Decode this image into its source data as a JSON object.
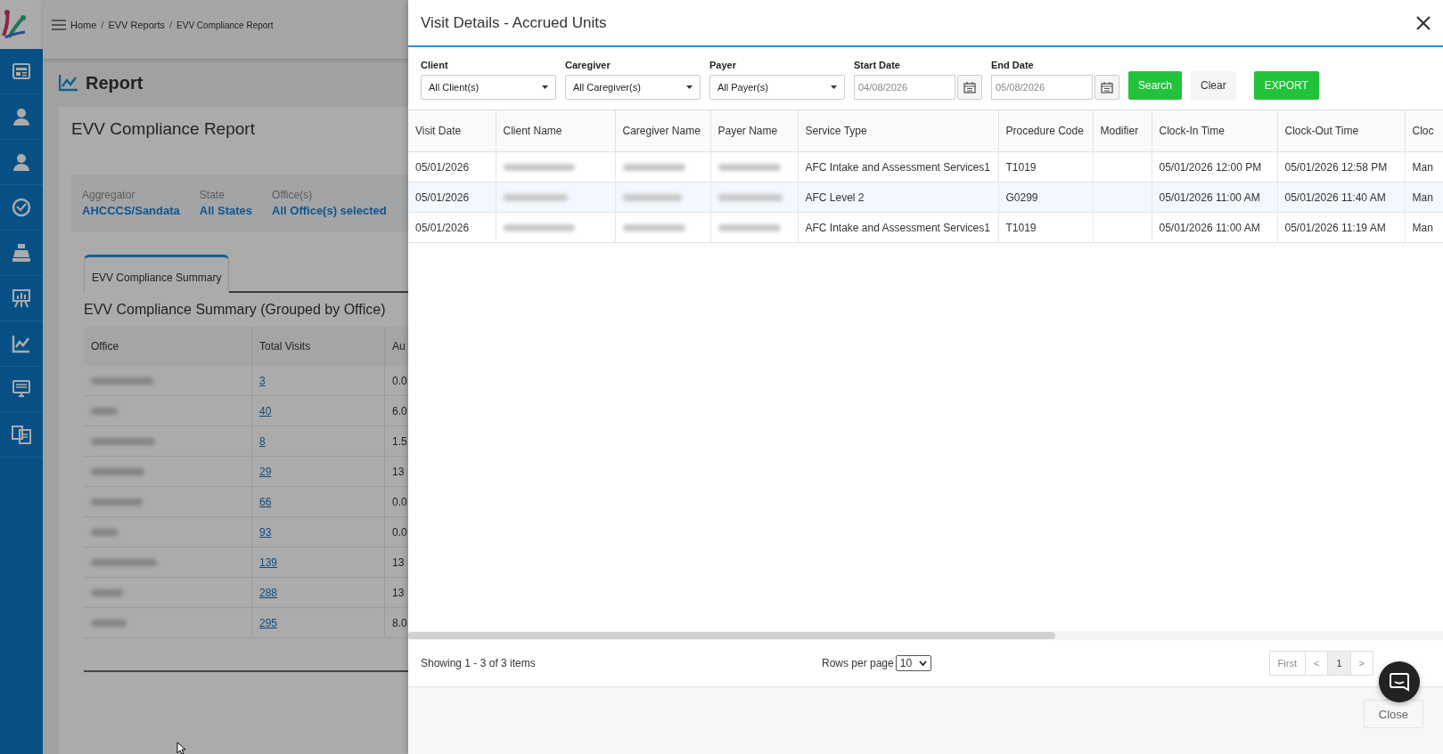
{
  "breadcrumb": {
    "items": [
      "Home",
      "EVV Reports",
      "EVV Compliance Report"
    ],
    "separator": "/"
  },
  "page_title": "Report",
  "report": {
    "title": "EVV Compliance Report",
    "filters": [
      {
        "label": "Aggregator",
        "value": "AHCCCS/Sandata"
      },
      {
        "label": "State",
        "value": "All States"
      },
      {
        "label": "Office(s)",
        "value": "All Office(s) selected"
      }
    ],
    "tabs": [
      {
        "label": "EVV Compliance Summary",
        "selected": true
      }
    ],
    "summary_title": "EVV Compliance Summary (Grouped by Office)",
    "table": {
      "columns": [
        "Office",
        "Total Visits",
        "Au"
      ],
      "rows": [
        {
          "total_visits": "3",
          "column_3": "0.0"
        },
        {
          "total_visits": "40",
          "column_3": "6.0"
        },
        {
          "total_visits": "8",
          "column_3": "1.5"
        },
        {
          "total_visits": "29",
          "column_3": "13"
        },
        {
          "total_visits": "66",
          "column_3": "0.0"
        },
        {
          "total_visits": "93",
          "column_3": "0.0"
        },
        {
          "total_visits": "139",
          "column_3": "13"
        },
        {
          "total_visits": "288",
          "column_3": "13"
        },
        {
          "total_visits": "295",
          "column_3": "8.0"
        }
      ]
    }
  },
  "modal": {
    "title": "Visit Details - Accrued Units",
    "filters": [
      {
        "label": "Client",
        "kind": "select",
        "value": "All Client(s)"
      },
      {
        "label": "Caregiver",
        "kind": "select",
        "value": "All Caregiver(s)"
      },
      {
        "label": "Payer",
        "kind": "select",
        "value": "All Payer(s)"
      },
      {
        "label": "Start Date",
        "kind": "date",
        "value": "04/08/2026"
      },
      {
        "label": "End Date",
        "kind": "date",
        "value": "05/08/2026"
      }
    ],
    "buttons": [
      {
        "label": "Search",
        "kind": "primary"
      },
      {
        "label": "Clear",
        "kind": "plain"
      },
      {
        "label": "EXPORT",
        "kind": "export"
      }
    ],
    "table": {
      "columns": [
        "Visit Date",
        "Client Name",
        "Caregiver Name",
        "Payer Name",
        "Service Type",
        "Procedure Code",
        "Modifier",
        "Clock-In Time",
        "Clock-Out Time",
        "Cloc"
      ],
      "rows": [
        {
          "highlighted": false,
          "visit_date": "05/01/2026",
          "service_type": "AFC Intake and Assessment Services1",
          "procedure_code": "T1019",
          "clock_in": "05/01/2026 12:00 PM",
          "clock_out": "05/01/2026 12:58 PM",
          "column_10": "Man"
        },
        {
          "highlighted": true,
          "visit_date": "05/01/2026",
          "service_type": "AFC Level 2",
          "procedure_code": "G0299",
          "clock_in": "05/01/2026 11:00 AM",
          "clock_out": "05/01/2026 11:40 AM",
          "column_10": "Man"
        },
        {
          "highlighted": false,
          "visit_date": "05/01/2026",
          "service_type": "AFC Intake and Assessment Services1",
          "procedure_code": "T1019",
          "clock_in": "05/01/2026 11:00 AM",
          "clock_out": "05/01/2026 11:19 AM",
          "column_10": "Man"
        }
      ]
    },
    "summary": "Showing 1 - 3 of 3 items",
    "rows_per_page": {
      "label": "Rows per page",
      "value": "10"
    },
    "pagination": [
      {
        "label": "First",
        "selected": false
      },
      {
        "label": "<",
        "selected": false
      },
      {
        "label": "1",
        "selected": true
      },
      {
        "label": ">",
        "selected": false
      }
    ],
    "close_button": "Close"
  }
}
